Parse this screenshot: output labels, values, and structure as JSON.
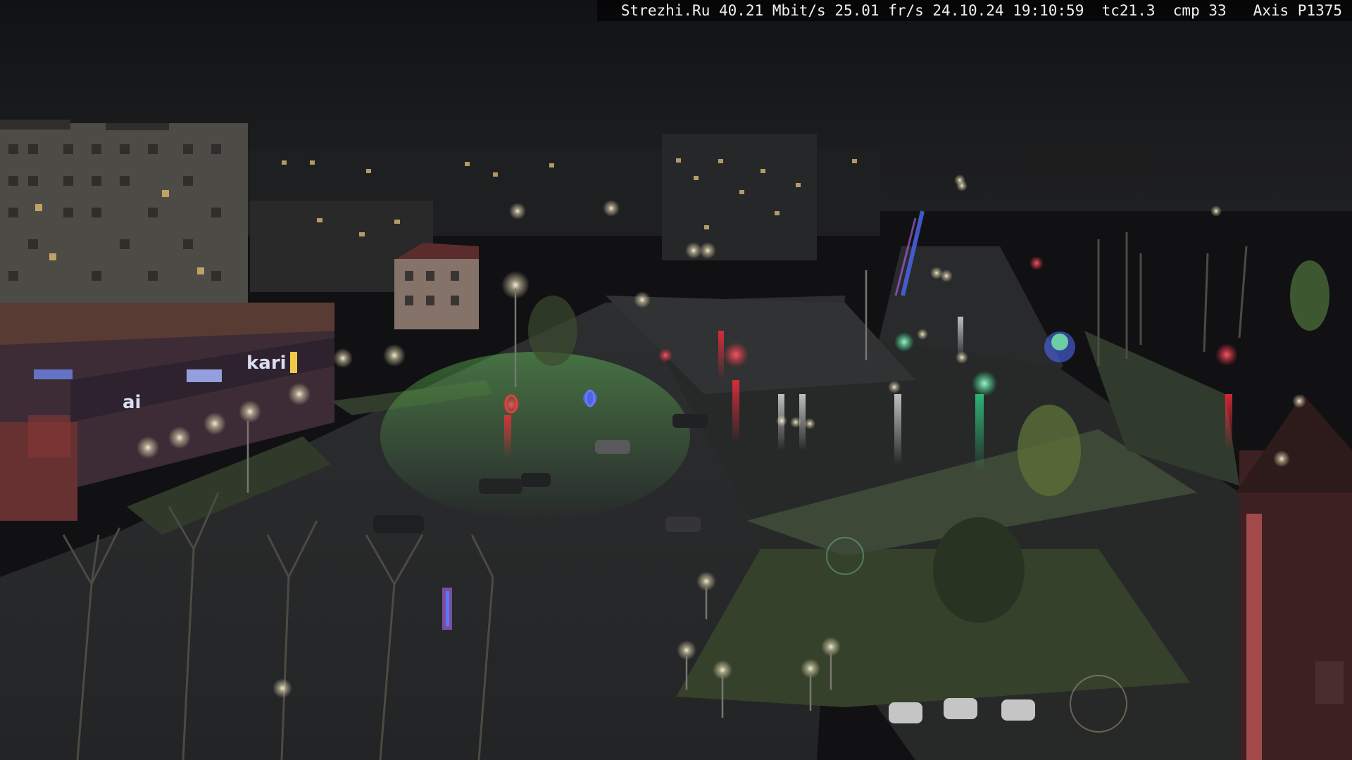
{
  "overlay": {
    "caption": "Strezhi.Ru 40.21 Mbit/s 25.01 fr/s 24.10.24 19:10:59  tc21.3  cmp 33   Axis P1375"
  },
  "scene": {
    "description_kind": "night-webcam-city-intersection",
    "signs": {
      "store_sign_main": "kari",
      "store_sign_shop": "ai"
    },
    "colors": {
      "sky": "#101113",
      "asphalt_wet": "#2b2d2e",
      "grass": "#3f4e35",
      "street_lamp": "#fff6d8",
      "traffic_red": "#ff2a3a",
      "traffic_green": "#2dff9a",
      "neon_blue": "#4d6bff",
      "building_facade": "#6f5a45"
    }
  }
}
